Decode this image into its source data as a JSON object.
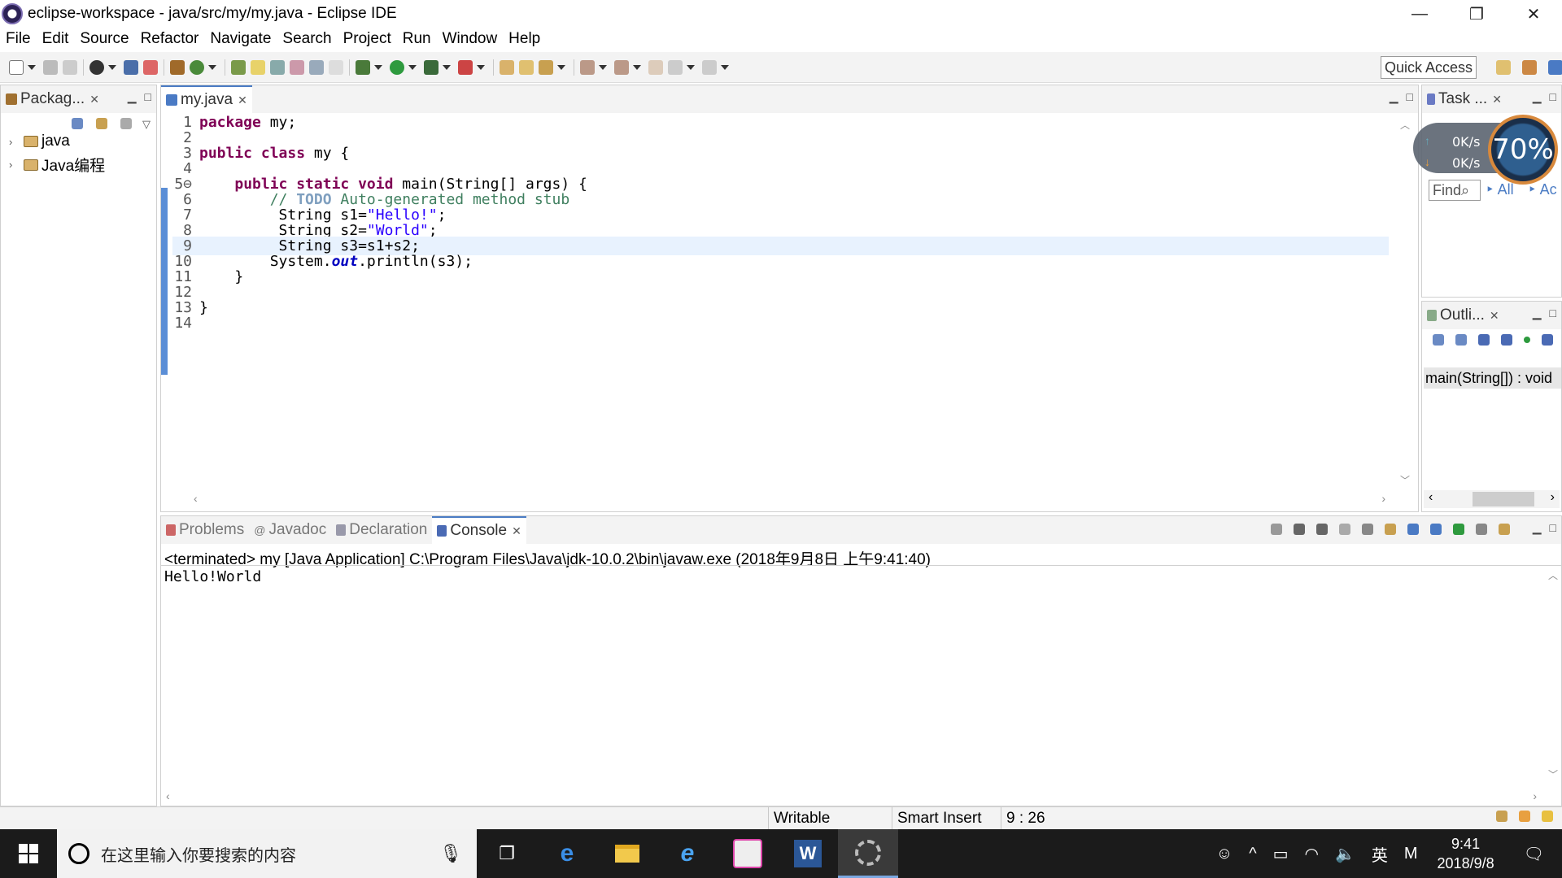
{
  "window": {
    "title": "eclipse-workspace - java/src/my/my.java - Eclipse IDE",
    "minimize": "—",
    "maximize": "❐",
    "close": "✕"
  },
  "menu": [
    "File",
    "Edit",
    "Source",
    "Refactor",
    "Navigate",
    "Search",
    "Project",
    "Run",
    "Window",
    "Help"
  ],
  "toolbar": {
    "quick_access": "Quick Access"
  },
  "package_explorer": {
    "tab_label": "Packag...",
    "items": [
      {
        "label": "java"
      },
      {
        "label": "Java编程"
      }
    ]
  },
  "editor": {
    "tab_label": "my.java",
    "lines": [
      {
        "n": "1"
      },
      {
        "n": "2"
      },
      {
        "n": "3"
      },
      {
        "n": "4"
      },
      {
        "n": "5⊖"
      },
      {
        "n": "6"
      },
      {
        "n": "7"
      },
      {
        "n": "8"
      },
      {
        "n": "9"
      },
      {
        "n": "10"
      },
      {
        "n": "11"
      },
      {
        "n": "12"
      },
      {
        "n": "13"
      },
      {
        "n": "14"
      }
    ],
    "code": {
      "l1_kw": "package",
      "l1_rest": " my;",
      "l3_kw": "public class",
      "l3_rest": " my {",
      "l5_indent": "    ",
      "l5_kw": "public static void",
      "l5_rest": " main(String[] args) {",
      "l6_indent": "        ",
      "l6_cm1": "// ",
      "l6_todo": "TODO",
      "l6_cm2": " Auto-generated method stub",
      "l7_pre": "         String s1=",
      "l7_str": "\"Hello!\"",
      "l7_post": ";",
      "l8_pre": "         String s2=",
      "l8_str": "\"World\"",
      "l8_post": ";",
      "l9": "         String s3=s1+s2;",
      "l10_pre": "        System.",
      "l10_fld": "out",
      "l10_post": ".println(s3);",
      "l11": "    }",
      "l13": "}"
    }
  },
  "task_list": {
    "tab_label": "Task ...",
    "find_placeholder": "Find",
    "all_label": "All",
    "ac_label": "Ac"
  },
  "network_widget": {
    "upload": "0K/s",
    "download": "0K/s",
    "percent": "70%"
  },
  "outline": {
    "tab_label": "Outli...",
    "selected_item": "main(String[]) : void"
  },
  "console": {
    "tabs": [
      {
        "label": "Problems"
      },
      {
        "label": "Javadoc"
      },
      {
        "label": "Declaration"
      },
      {
        "label": "Console"
      }
    ],
    "header": "<terminated> my [Java Application] C:\\Program Files\\Java\\jdk-10.0.2\\bin\\javaw.exe (2018年9月8日 上午9:41:40)",
    "output": "Hello!World"
  },
  "status": {
    "writable": "Writable",
    "insert_mode": "Smart Insert",
    "position": "9 : 26"
  },
  "taskbar": {
    "search_placeholder": "在这里输入你要搜索的内容",
    "ime": "英",
    "ime2": "M",
    "time": "9:41",
    "date": "2018/9/8"
  }
}
